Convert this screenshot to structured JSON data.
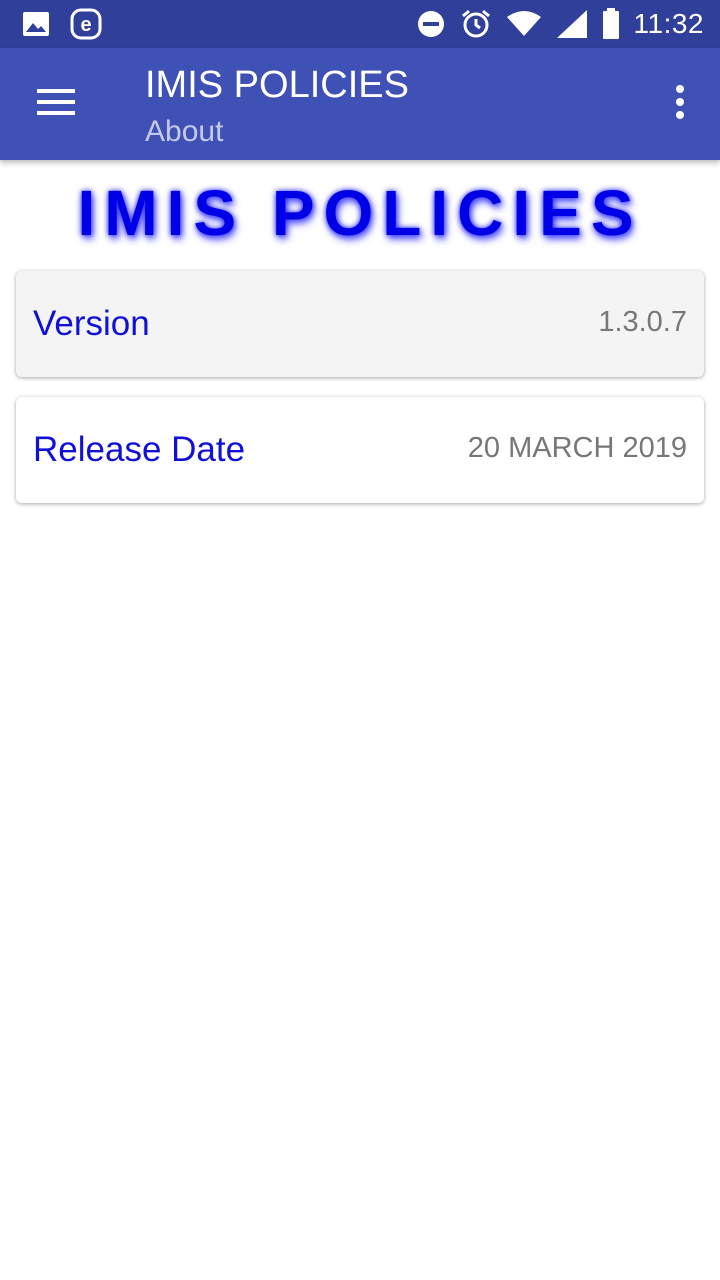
{
  "status_bar": {
    "time": "11:32",
    "icons": [
      "image-icon",
      "e-app-icon",
      "do-not-disturb-icon",
      "alarm-icon",
      "wifi-icon",
      "signal-icon",
      "battery-icon"
    ]
  },
  "app_bar": {
    "title": "IMIS POLICIES",
    "subtitle": "About",
    "background_color": "#3f51b5",
    "menu_icon": "hamburger-menu-icon",
    "overflow_icon": "more-vert-icon"
  },
  "banner": {
    "text": "IMIS POLICIES",
    "color": "#0000e6"
  },
  "info_cards": [
    {
      "label": "Version",
      "value": "1.3.0.7"
    },
    {
      "label": "Release Date",
      "value": "20 MARCH 2019"
    }
  ]
}
